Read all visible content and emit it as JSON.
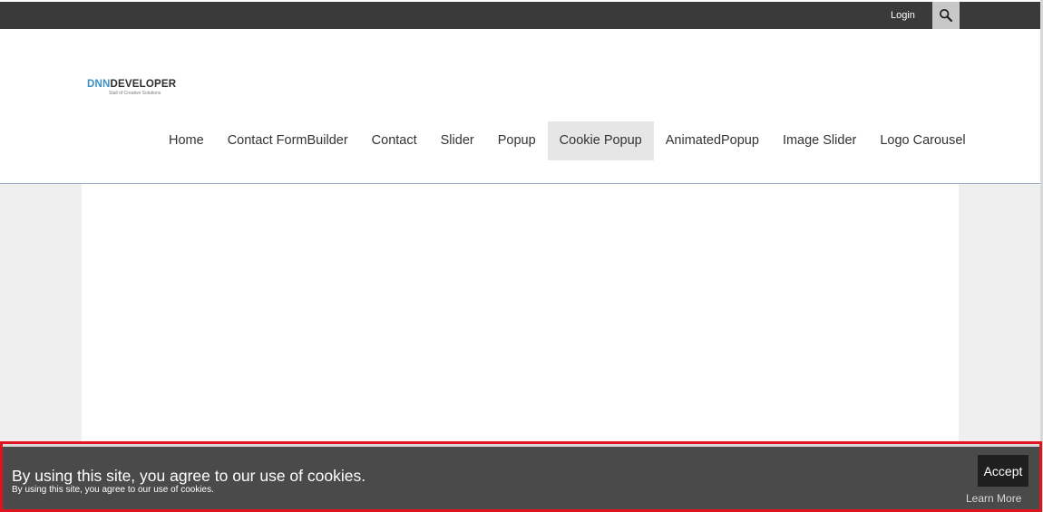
{
  "topbar": {
    "login_label": "Login",
    "search_icon": "search-icon"
  },
  "logo": {
    "part1": "DNN",
    "part2": "DEVELOPER",
    "tagline": "Stall of Creative Solutions"
  },
  "nav": {
    "items": [
      {
        "label": "Home"
      },
      {
        "label": "Contact FormBuilder"
      },
      {
        "label": "Contact"
      },
      {
        "label": "Slider"
      },
      {
        "label": "Popup"
      },
      {
        "label": "Cookie Popup",
        "active": true
      },
      {
        "label": "AnimatedPopup"
      },
      {
        "label": "Image Slider"
      },
      {
        "label": "Logo Carousel"
      }
    ]
  },
  "cookie": {
    "title": "By using this site, you agree to our use of cookies.",
    "subtitle": "By using this site, you agree to our use of cookies.",
    "accept_label": "Accept",
    "learn_more_label": "Learn More"
  },
  "colors": {
    "topbar": "#3a3a3a",
    "logo_accent": "#3d8fc6",
    "cookie_bg": "#4a4a4a",
    "highlight_border": "#e0141e",
    "accept_bg": "#1f1f1f"
  }
}
